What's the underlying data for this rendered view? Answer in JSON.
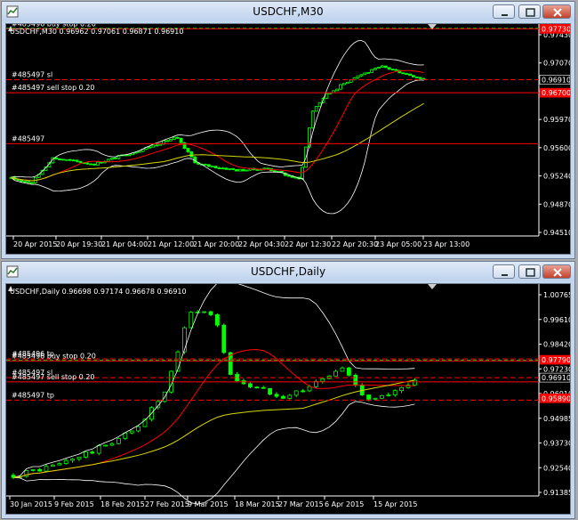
{
  "windows": [
    {
      "title": "USDCHF,M30",
      "info": "USDCHF,M30  0.96962 0.97061 0.96871 0.96910",
      "colors": {
        "bg": "#000000",
        "fg": "#ffffff",
        "bull": "#00ff00",
        "bear": "#00ff00",
        "bands": "#ffffff",
        "ma_red": "#ff0000",
        "ma_yellow": "#d7d700",
        "level": "#ff0000",
        "level_green": "#00c000"
      },
      "orders": [
        {
          "label": "#485496 buy stop 0.20",
          "price": 0.9773
        },
        {
          "label": "#485497 sl",
          "price": 0.9691
        },
        {
          "label": "#485497 sell stop 0.20",
          "price": 0.967
        },
        {
          "label": "#485497",
          "price": 0.9588
        }
      ],
      "price_axis": [
        "0.97430",
        "0.97070",
        "0.96340",
        "0.95970",
        "0.95600",
        "0.95240",
        "0.94870",
        "0.94510"
      ],
      "price_tags": [
        {
          "text": "0.97730",
          "price": 0.9773,
          "bg": "#ff0000"
        },
        {
          "text": "0.96910",
          "price": 0.9691,
          "bg": "#000000"
        },
        {
          "text": "0.96700",
          "price": 0.967,
          "bg": "#ff0000"
        }
      ],
      "time_axis": [
        "20 Apr 2015",
        "20 Apr 19:30",
        "21 Apr 04:00",
        "21 Apr 12:00",
        "21 Apr 20:00",
        "22 Apr 04:30",
        "22 Apr 12:30",
        "22 Apr 20:30",
        "23 Apr 05:00",
        "23 Apr 13:00"
      ],
      "ylim": [
        0.9445,
        0.9775
      ]
    },
    {
      "title": "USDCHF,Daily",
      "info": "USDCHF,Daily  0.96698 0.97174 0.96678 0.96910",
      "colors": {
        "bg": "#000000",
        "fg": "#ffffff",
        "bull": "#00ff00",
        "bear": "#00ff00",
        "bands": "#ffffff",
        "ma_red": "#ff0000",
        "ma_yellow": "#d7d700",
        "level": "#ff0000",
        "level_green": "#00c000"
      },
      "orders": [
        {
          "label": "#485496 tp",
          "price": 0.9783
        },
        {
          "label": "#485496 buy stop 0.20",
          "price": 0.9773
        },
        {
          "label": "#485497 sl",
          "price": 0.9691
        },
        {
          "label": "#485497 sell stop 0.20",
          "price": 0.967
        },
        {
          "label": "#485497 tp",
          "price": 0.958
        }
      ],
      "price_axis": [
        "1.00765",
        "0.99610",
        "0.98420",
        "0.97230",
        "0.96910",
        "0.94985",
        "0.93730",
        "0.92540",
        "0.91385"
      ],
      "price_tags": [
        {
          "text": "0.97790",
          "price": 0.9779,
          "bg": "#ff0000"
        },
        {
          "text": "0.96910",
          "price": 0.9691,
          "bg": "#000000"
        },
        {
          "text": "0.95890",
          "price": 0.9589,
          "bg": "#ff0000"
        }
      ],
      "time_axis": [
        "30 Jan 2015",
        "9 Feb 2015",
        "18 Feb 2015",
        "27 Feb 2015",
        "9 Mar 2015",
        "18 Mar 2015",
        "27 Mar 2015",
        "6 Apr 2015",
        "15 Apr 2015"
      ],
      "ylim": [
        0.9125,
        1.0135
      ]
    }
  ]
}
